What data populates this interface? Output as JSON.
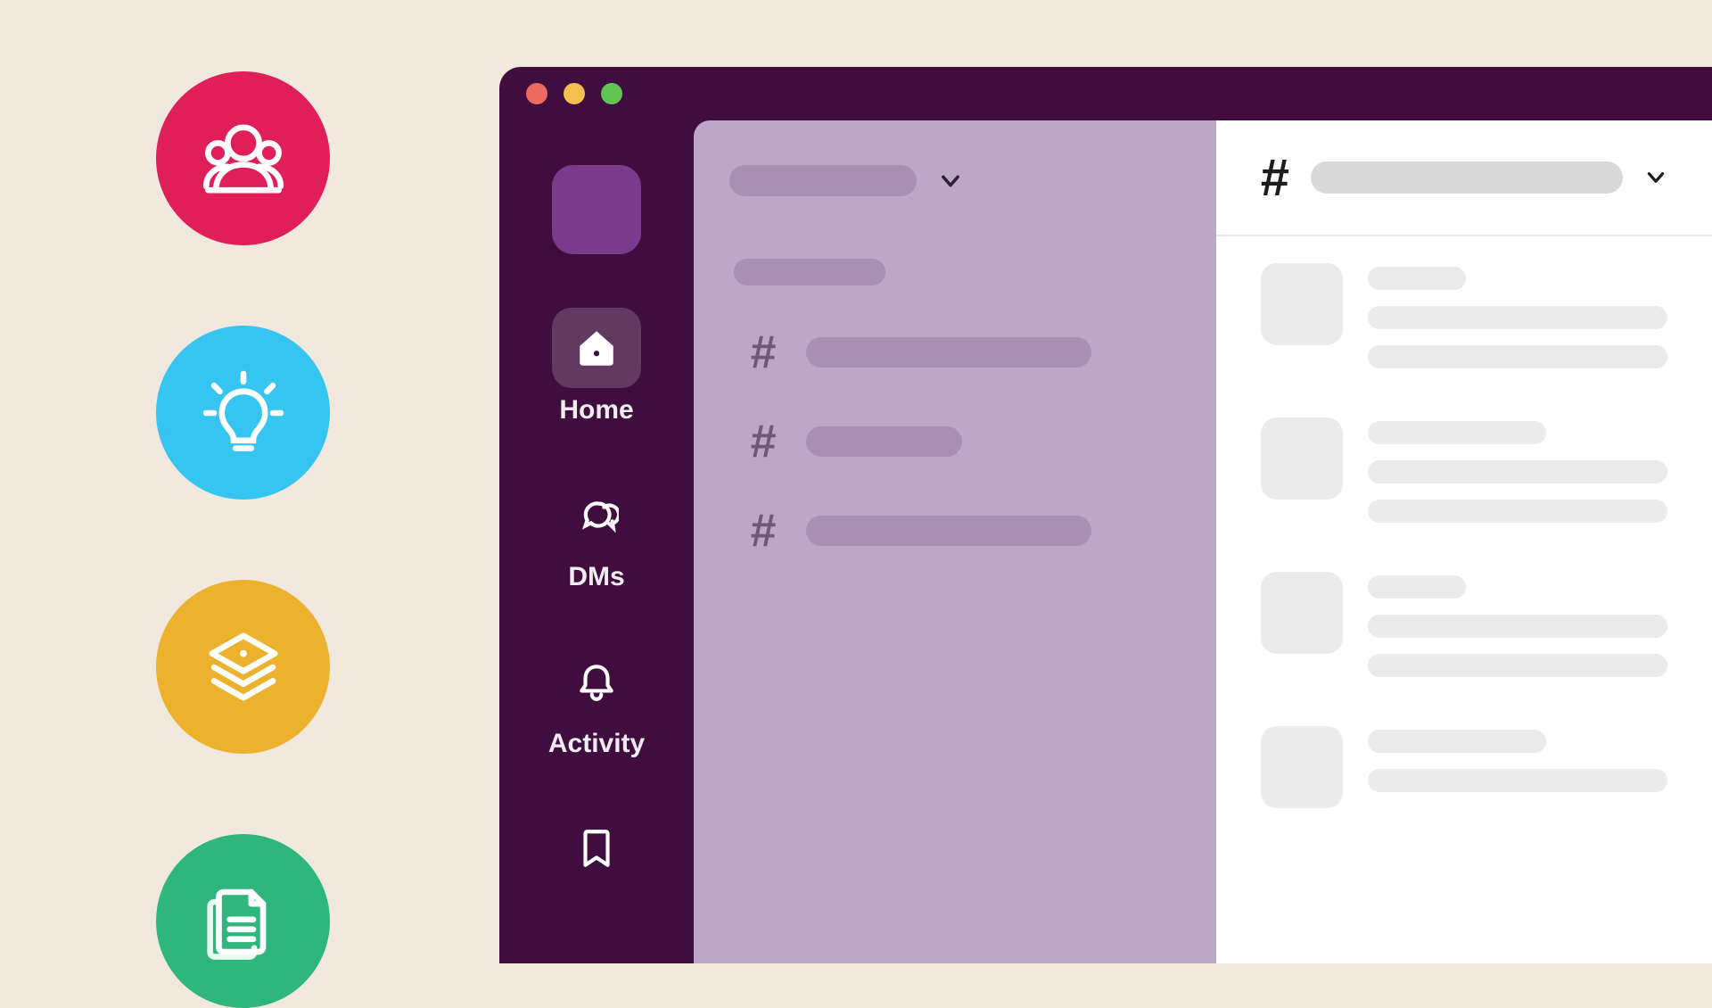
{
  "feature_icons": [
    {
      "name": "people-icon",
      "color": "#e01e5a"
    },
    {
      "name": "lightbulb-icon",
      "color": "#36c5f0"
    },
    {
      "name": "layers-lock-icon",
      "color": "#ecb22e"
    },
    {
      "name": "documents-icon",
      "color": "#2eb67d"
    }
  ],
  "window": {
    "traffic_lights": {
      "close": "#ec6b5e",
      "minimize": "#f4bf4f",
      "zoom": "#61c554"
    }
  },
  "rail": {
    "items": [
      {
        "id": "home",
        "label": "Home",
        "icon": "home-icon",
        "active": true
      },
      {
        "id": "dms",
        "label": "DMs",
        "icon": "chat-icon",
        "active": false
      },
      {
        "id": "activity",
        "label": "Activity",
        "icon": "bell-icon",
        "active": false
      },
      {
        "id": "later",
        "label": "",
        "icon": "bookmark-icon",
        "active": false
      }
    ]
  },
  "sidebar": {
    "workspace_name": "",
    "section_label": "",
    "channels": [
      {
        "name": "",
        "width": "long"
      },
      {
        "name": "",
        "width": "med"
      },
      {
        "name": "",
        "width": "long"
      }
    ]
  },
  "main": {
    "channel_name": "",
    "messages": [
      {
        "author": "",
        "lines": 2
      },
      {
        "author": "",
        "lines": 2
      },
      {
        "author": "",
        "lines": 2
      },
      {
        "author": "",
        "lines": 1
      }
    ]
  }
}
